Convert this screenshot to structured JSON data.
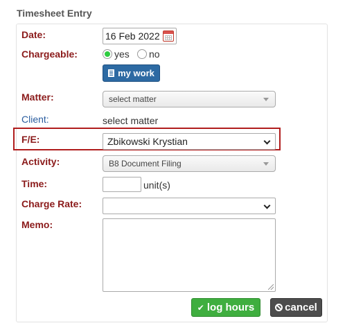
{
  "section_title": "Timesheet Entry",
  "labels": {
    "date": "Date:",
    "chargeable": "Chargeable:",
    "matter": "Matter:",
    "client": "Client:",
    "fe": "F/E:",
    "activity": "Activity:",
    "time": "Time:",
    "charge_rate": "Charge Rate:",
    "memo": "Memo:"
  },
  "date_value": "16 Feb 2022",
  "chargeable": {
    "yes_label": "yes",
    "no_label": "no",
    "selected": "yes"
  },
  "my_work_label": "my work",
  "matter_select": "select matter",
  "client_value": "select matter",
  "fe_select": "Zbikowski Krystian",
  "activity_select": "B8 Document Filing",
  "time_value": "",
  "time_unit": "unit(s)",
  "charge_rate_select": "",
  "memo_value": "",
  "buttons": {
    "log_hours": "log hours",
    "cancel": "cancel"
  },
  "colors": {
    "label_red": "#8b1a1a",
    "client_blue": "#2a5d9f",
    "highlight": "#b01c1c",
    "log_green": "#3fae3f",
    "cancel_grey": "#4d4d4d",
    "mywork_blue": "#2d6aa3"
  }
}
